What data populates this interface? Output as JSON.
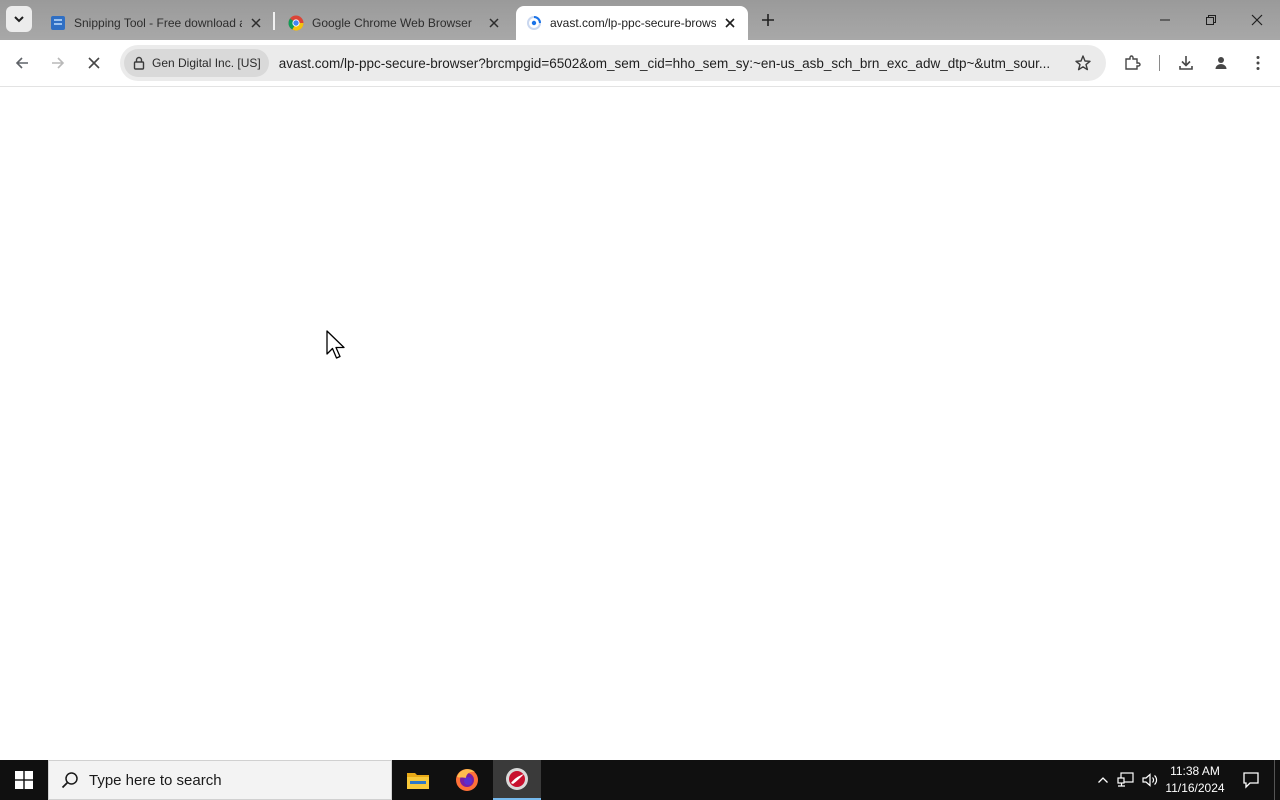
{
  "browser": {
    "tabs": [
      {
        "title": "Snipping Tool - Free download and",
        "active": false,
        "favicon": "snipping-tool-icon"
      },
      {
        "title": "Google Chrome Web Browser",
        "active": false,
        "favicon": "chrome-icon"
      },
      {
        "title": "avast.com/lp-ppc-secure-browser",
        "active": true,
        "favicon": "loading-spinner-icon"
      }
    ],
    "new_tab_icon": "plus-icon",
    "window_controls": [
      "minimize-icon",
      "restore-icon",
      "close-icon"
    ]
  },
  "toolbar": {
    "site_identity": "Gen Digital Inc. [US]",
    "url": "avast.com/lp-ppc-secure-browser?brcmpgid=6502&om_sem_cid=hho_sem_sy:~en-us_asb_sch_brn_exc_adw_dtp~&utm_sour...",
    "loading": true
  },
  "taskbar": {
    "search_placeholder": "Type here to search",
    "apps": [
      "file-explorer-icon",
      "firefox-icon",
      "avast-browser-icon"
    ],
    "time": "11:38 AM",
    "date": "11/16/2024"
  },
  "colors": {
    "tabstrip": "#a1a1a1",
    "omnibox": "#ebebeb",
    "taskbar": "#101010",
    "active_app_underline": "#76b9ed"
  }
}
